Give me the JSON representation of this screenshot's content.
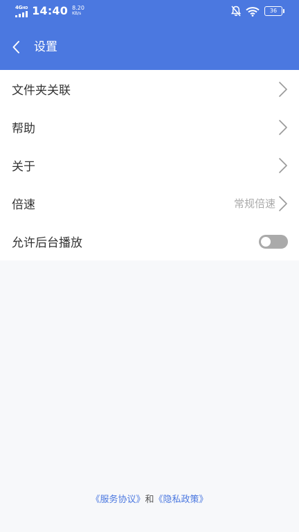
{
  "status_bar": {
    "network": "4G",
    "network_sub": "HD",
    "time": "14:40",
    "speed_value": "8.20",
    "speed_unit": "KB/s",
    "battery": "36"
  },
  "header": {
    "title": "设置"
  },
  "colors": {
    "accent": "#4b78e0",
    "toggle_off": "#aaaaaa"
  },
  "settings": {
    "items": [
      {
        "label": "文件夹关联",
        "icon": "chevron-right-icon"
      },
      {
        "label": "帮助",
        "icon": "chevron-right-icon"
      },
      {
        "label": "关于",
        "icon": "chevron-right-icon"
      },
      {
        "label": "倍速",
        "value": "常规倍速",
        "icon": "chevron-right-icon"
      },
      {
        "label": "允许后台播放",
        "toggle": "off"
      }
    ]
  },
  "footer": {
    "service_agreement": "《服务协议》",
    "and": "和",
    "privacy_policy": "《隐私政策》"
  }
}
